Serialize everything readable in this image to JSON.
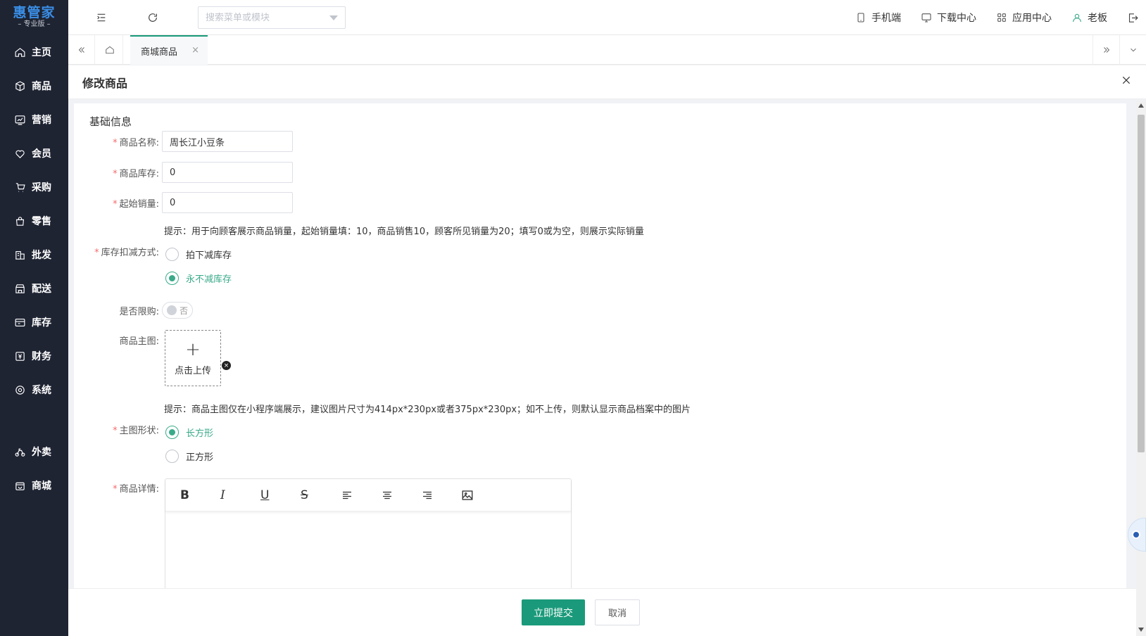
{
  "app": {
    "brand": "惠管家",
    "edition": "专业版"
  },
  "sidebar": {
    "items": [
      {
        "label": "主页",
        "icon": "home-icon"
      },
      {
        "label": "商品",
        "icon": "box-icon"
      },
      {
        "label": "营销",
        "icon": "chart-icon"
      },
      {
        "label": "会员",
        "icon": "heart-icon"
      },
      {
        "label": "采购",
        "icon": "purchase-icon"
      },
      {
        "label": "零售",
        "icon": "bag-icon"
      },
      {
        "label": "批发",
        "icon": "building-icon"
      },
      {
        "label": "配送",
        "icon": "store-icon"
      },
      {
        "label": "库存",
        "icon": "inventory-icon"
      },
      {
        "label": "财务",
        "icon": "finance-icon"
      },
      {
        "label": "系统",
        "icon": "settings-icon"
      }
    ],
    "extra_items": [
      {
        "label": "外卖",
        "icon": "bike-icon"
      },
      {
        "label": "商城",
        "icon": "mall-icon"
      }
    ]
  },
  "topbar": {
    "search_placeholder": "搜索菜单或模块",
    "links": {
      "mobile": "手机端",
      "download": "下载中心",
      "apps": "应用中心",
      "user": "老板"
    }
  },
  "tabs": {
    "active": "商城商品",
    "close": "×"
  },
  "page": {
    "title": "修改商品",
    "section": "基础信息"
  },
  "form": {
    "name": {
      "label": "商品名称:",
      "value": "周长江小豆条"
    },
    "stock": {
      "label": "商品库存:",
      "value": "0"
    },
    "initial_sales": {
      "label": "起始销量:",
      "value": "0"
    },
    "sales_hint": "提示：用于向顾客展示商品销量，起始销量填：10，商品销售10，顾客所见销量为20；填写0或为空，则展示实际销量",
    "deduct_mode": {
      "label": "库存扣减方式:",
      "options": [
        "拍下减库存",
        "永不减库存"
      ],
      "selected": "永不减库存"
    },
    "limit": {
      "label": "是否限购:",
      "value": "否"
    },
    "main_image": {
      "label": "商品主图:",
      "upload": "点击上传",
      "plus": "+",
      "remove": "×"
    },
    "image_hint": "提示：商品主图仅在小程序端展示，建议图片尺寸为414px*230px或者375px*230px；如不上传，则默认显示商品档案中的图片",
    "image_shape": {
      "label": "主图形状:",
      "options": [
        "长方形",
        "正方形"
      ],
      "selected": "长方形"
    },
    "detail": {
      "label": "商品详情:",
      "toolbar": {
        "bold": "B",
        "italic": "I",
        "underline": "U",
        "strike": "S"
      }
    },
    "required_mark": "*"
  },
  "footer": {
    "submit": "立即提交",
    "cancel": "取消"
  },
  "colors": {
    "sidebar_bg": "#1f2433",
    "primary": "#1a9a7a",
    "accent_green": "#3aaa8a",
    "required": "#f56c6c"
  }
}
